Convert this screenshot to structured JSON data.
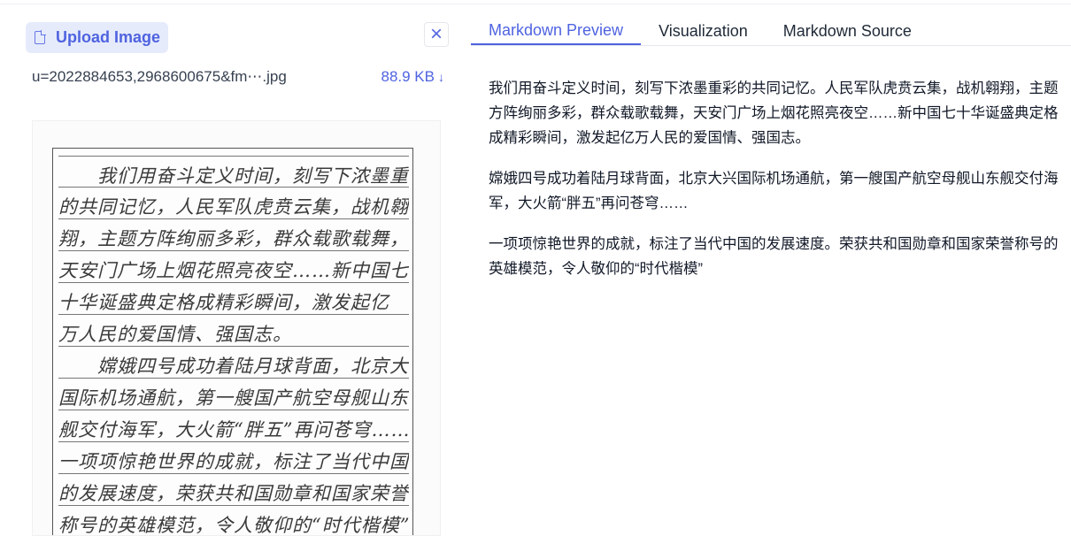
{
  "upload": {
    "button_label": "Upload Image",
    "file_name": "u=2022884653,2968600675&fm⋯.jpg",
    "file_size": "88.9 KB",
    "download_glyph": "↓",
    "close_glyph": "×"
  },
  "handwriting": {
    "lines": [
      "　　我们用奋斗定义时间，刻写下浓墨重彩",
      "的共同记忆，人民军队虎贲云集，战机翱",
      "翔，主题方阵绚丽多彩，群众载歌载舞，",
      "天安门广场上烟花照亮夜空……新中国七",
      "十华诞盛典定格成精彩瞬间，激发起亿",
      "万人民的爱国情、强国志。",
      "　　嫦娥四号成功着陆月球背面，北京大兴",
      "国际机场通航，第一艘国产航空母舰山东",
      "舰交付海军，大火箭“胖五”再问苍穹……",
      "一项项惊艳世界的成就，标注了当代中国",
      "的发展速度，荣获共和国勋章和国家荣誉",
      "称号的英雄模范，令人敬仰的“时代楷模”"
    ]
  },
  "tabs": [
    {
      "label": "Markdown Preview",
      "active": true
    },
    {
      "label": "Visualization",
      "active": false
    },
    {
      "label": "Markdown Source",
      "active": false
    }
  ],
  "preview": {
    "paragraphs": [
      "我们用奋斗定义时间，刻写下浓墨重彩的共同记忆。人民军队虎贲云集，战机翱翔，主题方阵绚丽多彩，群众载歌载舞，天安门广场上烟花照亮夜空……新中国七十华诞盛典定格成精彩瞬间，激发起亿万人民的爱国情、强国志。",
      "嫦娥四号成功着陆月球背面，北京大兴国际机场通航，第一艘国产航空母舰山东舰交付海军，大火箭“胖五”再问苍穹……",
      "一项项惊艳世界的成就，标注了当代中国的发展速度。荣获共和国勋章和国家荣誉称号的英雄模范，令人敬仰的“时代楷模”"
    ]
  },
  "colors": {
    "accent": "#4f63e0",
    "accent_bg": "#e6ebfb"
  }
}
